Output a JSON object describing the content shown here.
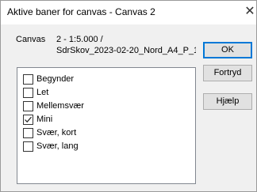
{
  "window": {
    "title": "Aktive baner for canvas - Canvas 2",
    "close_glyph": "✕"
  },
  "canvas": {
    "label": "Canvas",
    "value_line1": "2 - 1:5.000 /",
    "value_line2": "SdrSkov_2023-02-20_Nord_A4_P_1"
  },
  "buttons": {
    "ok": "OK",
    "cancel": "Fortryd",
    "help": "Hjælp"
  },
  "tracks": [
    {
      "label": "Begynder",
      "checked": false
    },
    {
      "label": "Let",
      "checked": false
    },
    {
      "label": "Mellemsvær",
      "checked": false
    },
    {
      "label": "Mini",
      "checked": true
    },
    {
      "label": "Svær, kort",
      "checked": false
    },
    {
      "label": "Svær, lang",
      "checked": false
    }
  ],
  "colors": {
    "dialog_bg": "#f0f0f0",
    "default_button_border": "#0078d7"
  }
}
